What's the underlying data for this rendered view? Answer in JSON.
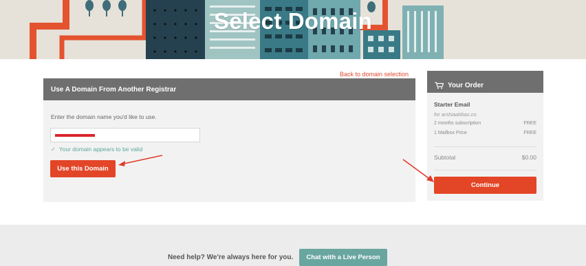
{
  "hero": {
    "title": "Select Domain"
  },
  "back_link": "Back to domain selection",
  "panel": {
    "title": "Use A Domain From Another Registrar",
    "description": "Enter the domain name you'd like to use.",
    "input_value": "",
    "validation_message": "Your domain appears to be valid",
    "use_button": "Use this Domain"
  },
  "order": {
    "title": "Your Order",
    "item_name": "Starter Email",
    "item_for": "for arshiaabbas.co",
    "rows": [
      {
        "label": "2 months subscription",
        "value": "FREE"
      },
      {
        "label": "1 Mailbox Price",
        "value": "FREE"
      }
    ],
    "subtotal_label": "Subtotal",
    "subtotal_value": "$0.00",
    "continue_button": "Continue"
  },
  "footer": {
    "help_text": "Need help? We're always here for you.",
    "chat_button": "Chat with a Live Person"
  },
  "colors": {
    "accent": "#e34527",
    "header_gray": "#6f6f6f",
    "valid_teal": "#5fa79a",
    "chat_teal": "#6aa6a0",
    "redaction_red": "#d9262b"
  },
  "icons": [
    "check-icon",
    "cart-icon",
    "annotation-arrow"
  ]
}
